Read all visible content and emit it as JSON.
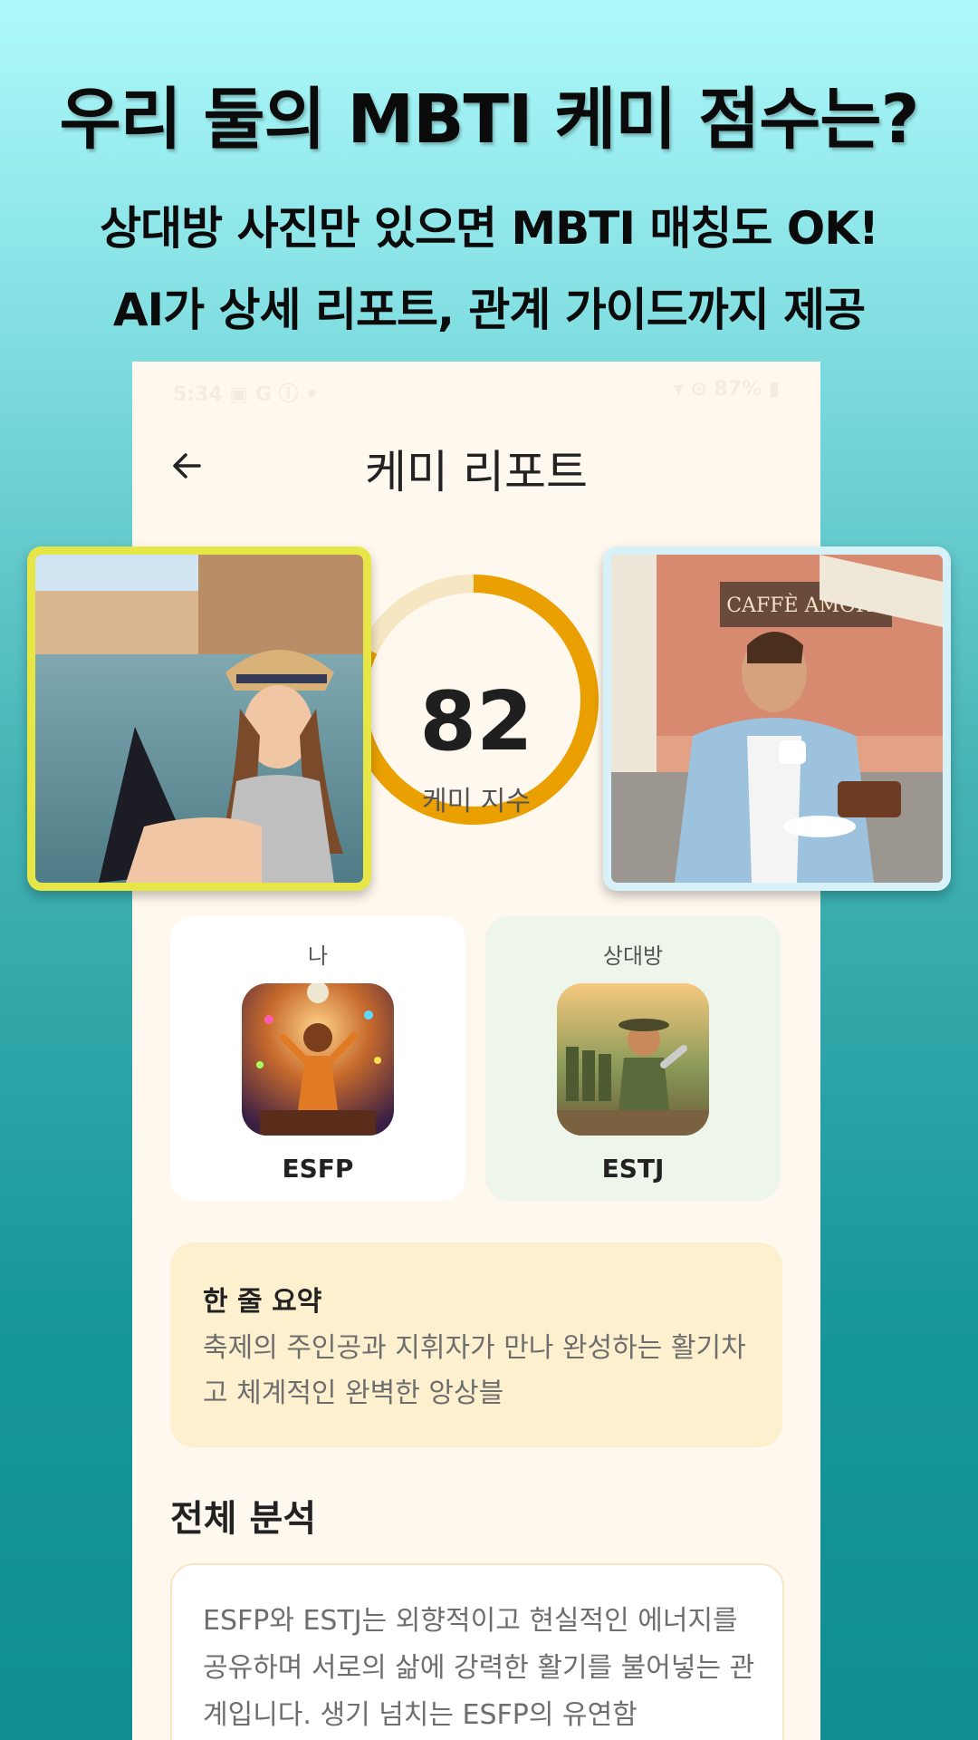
{
  "promo": {
    "title": "우리 둘의 MBTI 케미 점수는?",
    "subtitle_line1": "상대방 사진만 있으면 MBTI  매칭도  OK!",
    "subtitle_line2": "AI가 상세 리포트, 관계 가이드까지 제공"
  },
  "status_bar": {
    "left": "5:34 ▣ G ⓘ •",
    "right": "▾ ⊙ 87% ▮"
  },
  "header": {
    "title": "케미 리포트",
    "back_icon": "arrow-left-icon"
  },
  "chemistry": {
    "score": "82",
    "score_value": 82,
    "label": "케미 지수",
    "ring_color": "#e9a000",
    "track_color": "#f6e6c2"
  },
  "profiles": {
    "me": {
      "role": "나",
      "type": "ESFP"
    },
    "partner": {
      "role": "상대방",
      "type": "ESTJ"
    }
  },
  "summary": {
    "heading": "한 줄 요약",
    "text": "축제의 주인공과 지휘자가 만나 완성하는 활기차고 체계적인 완벽한 앙상블"
  },
  "analysis": {
    "heading": "전체 분석",
    "text": "ESFP와 ESTJ는 외향적이고 현실적인 에너지를 공유하며 서로의 삶에 강력한 활기를 불어넣는 관계입니다. 생기 넘치는 ESFP의 유연함"
  },
  "colors": {
    "accent": "#e9a000",
    "left_frame": "#e6e747",
    "right_frame": "#d6f1f7"
  }
}
